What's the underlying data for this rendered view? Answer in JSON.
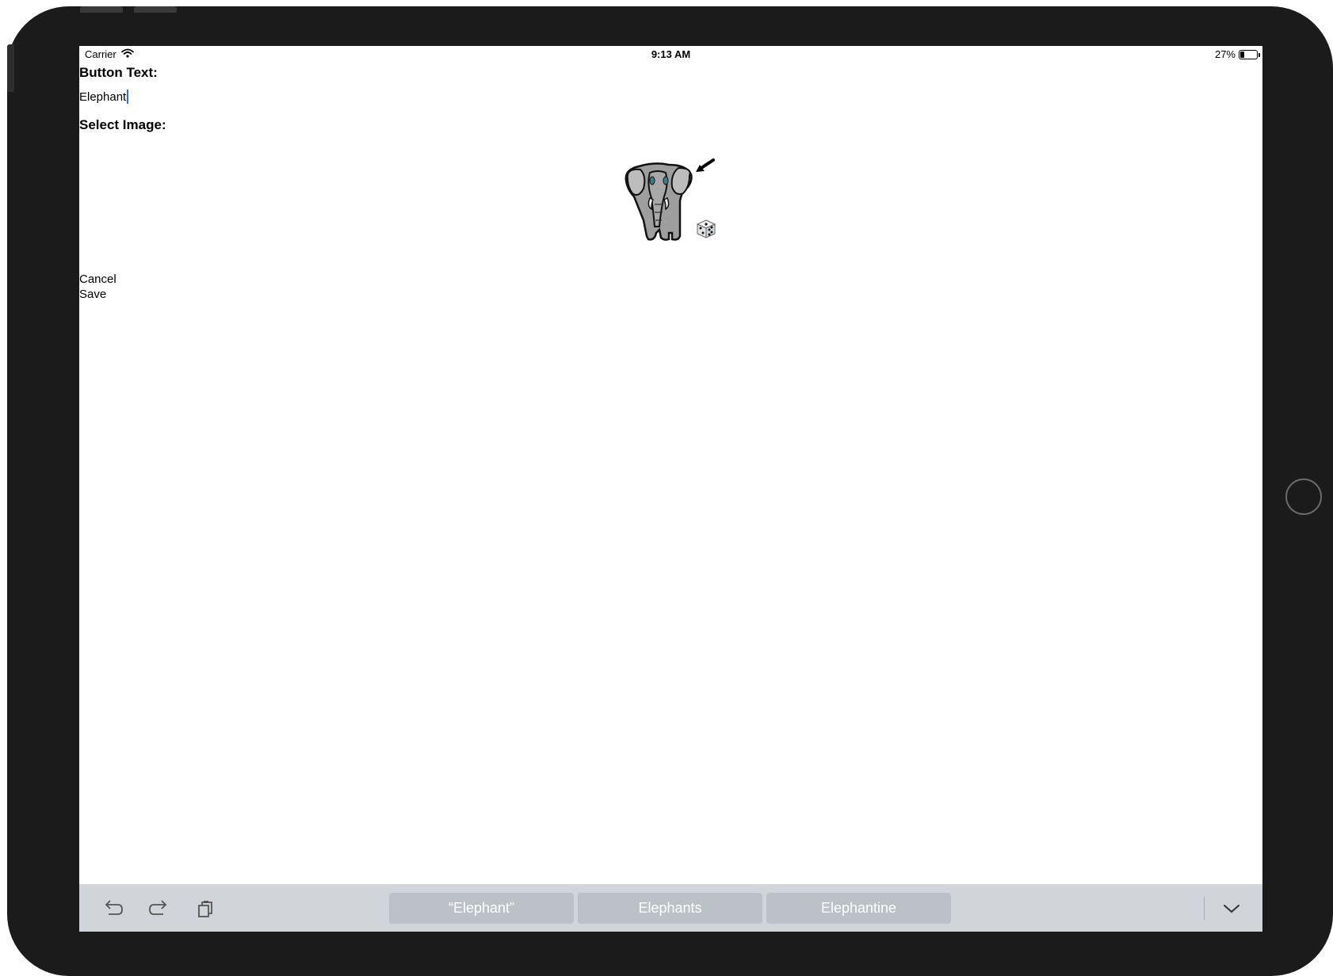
{
  "status_bar": {
    "carrier": "Carrier",
    "time": "9:13 AM",
    "battery_percent_label": "27%",
    "battery_level": 0.27,
    "wifi_icon": "wifi-icon"
  },
  "form": {
    "button_text_label": "Button Text:",
    "button_text_value": "Elephant",
    "select_image_label": "Select Image:",
    "image_icon": "elephant-image",
    "random_icon": "dice-icon"
  },
  "actions": {
    "cancel_label": "Cancel",
    "save_label": "Save"
  },
  "keyboard_bar": {
    "icons": [
      "undo-icon",
      "redo-icon",
      "paste-icon",
      "dismiss-keyboard-icon"
    ],
    "suggestions": [
      "“Elephant”",
      "Elephants",
      "Elephantine"
    ]
  },
  "colors": {
    "bezel": "#1b1b1b",
    "bar_background": "#d1d4d9",
    "suggestion_background": "#bcc0c7",
    "caret": "#2f6ce6"
  }
}
